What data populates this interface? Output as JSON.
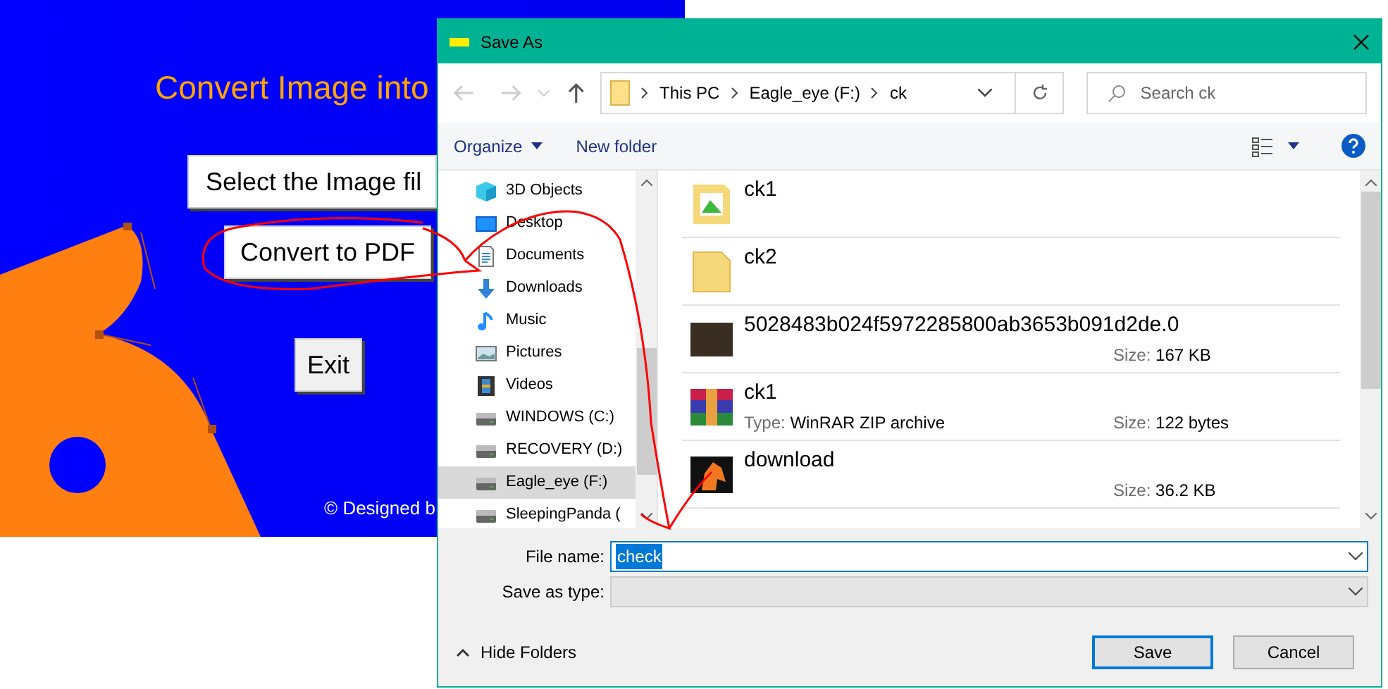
{
  "app": {
    "title": "Convert Image into",
    "buttons": [
      "Select the Image fil",
      "Convert to PDF",
      "Exit"
    ],
    "footer": "© Designed b"
  },
  "dialog": {
    "title": "Save As",
    "breadcrumb": [
      "This PC",
      "Eagle_eye (F:)",
      "ck"
    ],
    "search": {
      "placeholder": "Search ck"
    },
    "toolbar": [
      "Organize",
      "New folder"
    ],
    "nav_items": [
      {
        "label": "3D Objects",
        "kind": "cube",
        "selected": false
      },
      {
        "label": "Desktop",
        "kind": "desktop",
        "selected": false
      },
      {
        "label": "Documents",
        "kind": "documents",
        "selected": false
      },
      {
        "label": "Downloads",
        "kind": "downloads",
        "selected": false
      },
      {
        "label": "Music",
        "kind": "music",
        "selected": false
      },
      {
        "label": "Pictures",
        "kind": "pictures",
        "selected": false
      },
      {
        "label": "Videos",
        "kind": "videos",
        "selected": false
      },
      {
        "label": "WINDOWS (C:)",
        "kind": "drive",
        "selected": false
      },
      {
        "label": "RECOVERY (D:)",
        "kind": "drive",
        "selected": false
      },
      {
        "label": "Eagle_eye (F:)",
        "kind": "drive",
        "selected": true
      },
      {
        "label": "SleepingPanda (",
        "kind": "drive",
        "selected": false
      }
    ],
    "files": [
      {
        "name": "ck1",
        "kind": "folder-image"
      },
      {
        "name": "ck2",
        "kind": "folder"
      },
      {
        "name": "5028483b024f5972285800ab3653b091d2de.0",
        "kind": "photo",
        "size": {
          "label": "Size:",
          "value": "167 KB"
        }
      },
      {
        "name": "ck1",
        "kind": "archive",
        "type": {
          "label": "Type:",
          "value": "WinRAR ZIP archive"
        },
        "size": {
          "label": "Size:",
          "value": "122 bytes"
        }
      },
      {
        "name": "download",
        "kind": "horse",
        "size": {
          "label": "Size:",
          "value": "36.2 KB"
        }
      }
    ],
    "file_name": {
      "label": "File name:",
      "value": "check"
    },
    "save_as_type": {
      "label": "Save as type:"
    },
    "hide_folders": "Hide Folders",
    "buttons": [
      "Save",
      "Cancel"
    ]
  }
}
